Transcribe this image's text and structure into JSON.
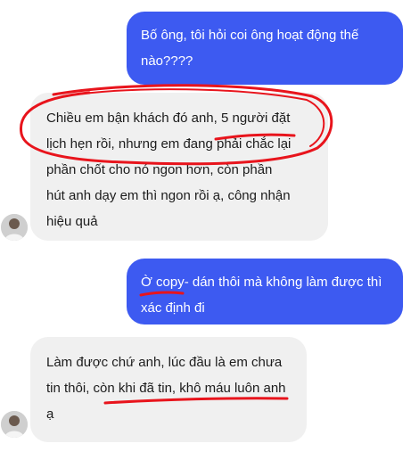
{
  "conversation": {
    "messages": [
      {
        "sender": "me",
        "lines": [
          "Bố ông, tôi hỏi coi ông hoạt động thế",
          "nào????"
        ]
      },
      {
        "sender": "contact",
        "lines": [
          "Chiều em bận khách đó anh, 5 người đặt",
          "lịch hẹn rồi, nhưng em đang phải chắc lại",
          "phần chốt cho nó ngon hơn, còn phần",
          "hút anh dạy em thì ngon rồi ạ, công nhận",
          "hiệu quả"
        ]
      },
      {
        "sender": "me",
        "lines": [
          "Ờ copy- dán thôi mà không làm được thì",
          "xác định đi"
        ]
      },
      {
        "sender": "contact",
        "lines": [
          "Làm được chứ anh, lúc đầu là em chưa",
          "tin thôi, còn khi đã tin, khô máu luôn anh",
          "ạ"
        ]
      }
    ]
  },
  "colors": {
    "outgoing_bubble": "#3d5af1",
    "incoming_bubble": "#f0f0f0",
    "annotation_ink": "#e8141c"
  }
}
